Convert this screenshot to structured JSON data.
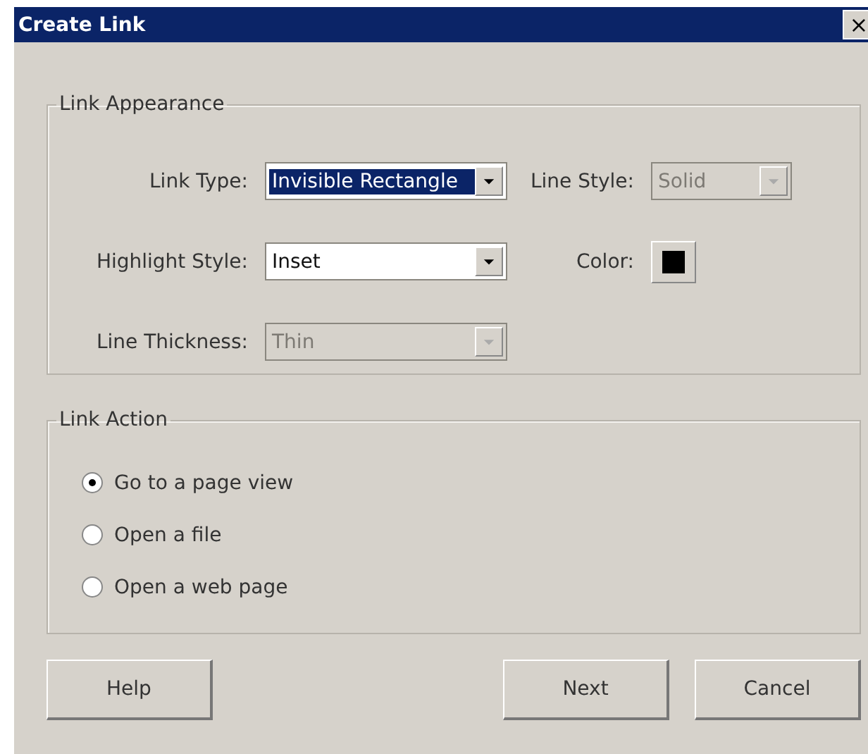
{
  "window": {
    "title": "Create Link",
    "close": "×"
  },
  "appearance": {
    "legend": "Link Appearance",
    "rows": [
      [
        {
          "kind": "select",
          "label": "Link Type:",
          "value": "Invisible Rectangle",
          "disabled": false,
          "highlighted": true
        },
        {
          "kind": "select",
          "label": "Line Style:",
          "value": "Solid",
          "disabled": true,
          "highlighted": false
        }
      ],
      [
        {
          "kind": "select",
          "label": "Highlight Style:",
          "value": "Inset",
          "disabled": false,
          "highlighted": false
        },
        {
          "kind": "color",
          "label": "Color:",
          "color": "#000000"
        }
      ],
      [
        {
          "kind": "select",
          "label": "Line Thickness:",
          "value": "Thin",
          "disabled": true,
          "highlighted": false
        }
      ]
    ]
  },
  "action": {
    "legend": "Link Action",
    "options": [
      {
        "label": "Go to a page view",
        "selected": true
      },
      {
        "label": "Open a file",
        "selected": false
      },
      {
        "label": "Open a web page",
        "selected": false
      }
    ]
  },
  "buttons": [
    "Help",
    "Next",
    "Cancel"
  ]
}
